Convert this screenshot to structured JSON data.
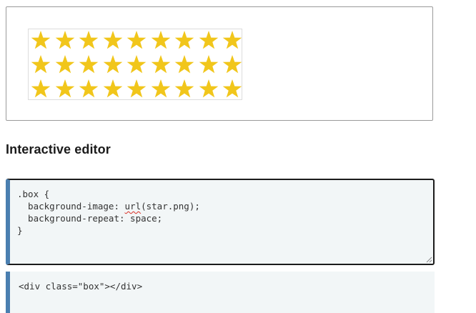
{
  "output": {
    "star_rows": 3,
    "star_columns": 9,
    "star_color": "#f1c61b",
    "star_icon": "star-icon"
  },
  "section": {
    "heading": "Interactive editor"
  },
  "css_editor": {
    "lines": [
      {
        "prefix": ".box {",
        "squiggle": "",
        "suffix": ""
      },
      {
        "prefix": "  background-image: ",
        "squiggle": "url",
        "suffix": "(star.png);"
      },
      {
        "prefix": "  background-repeat: space;",
        "squiggle": "",
        "suffix": ""
      },
      {
        "prefix": "}",
        "squiggle": "",
        "suffix": ""
      }
    ]
  },
  "html_editor": {
    "code": "<div class=\"box\"></div>"
  },
  "colors": {
    "accent_border": "#4a7fb0",
    "editor_bg": "#f2f6f7",
    "spellcheck": "#d93025"
  }
}
